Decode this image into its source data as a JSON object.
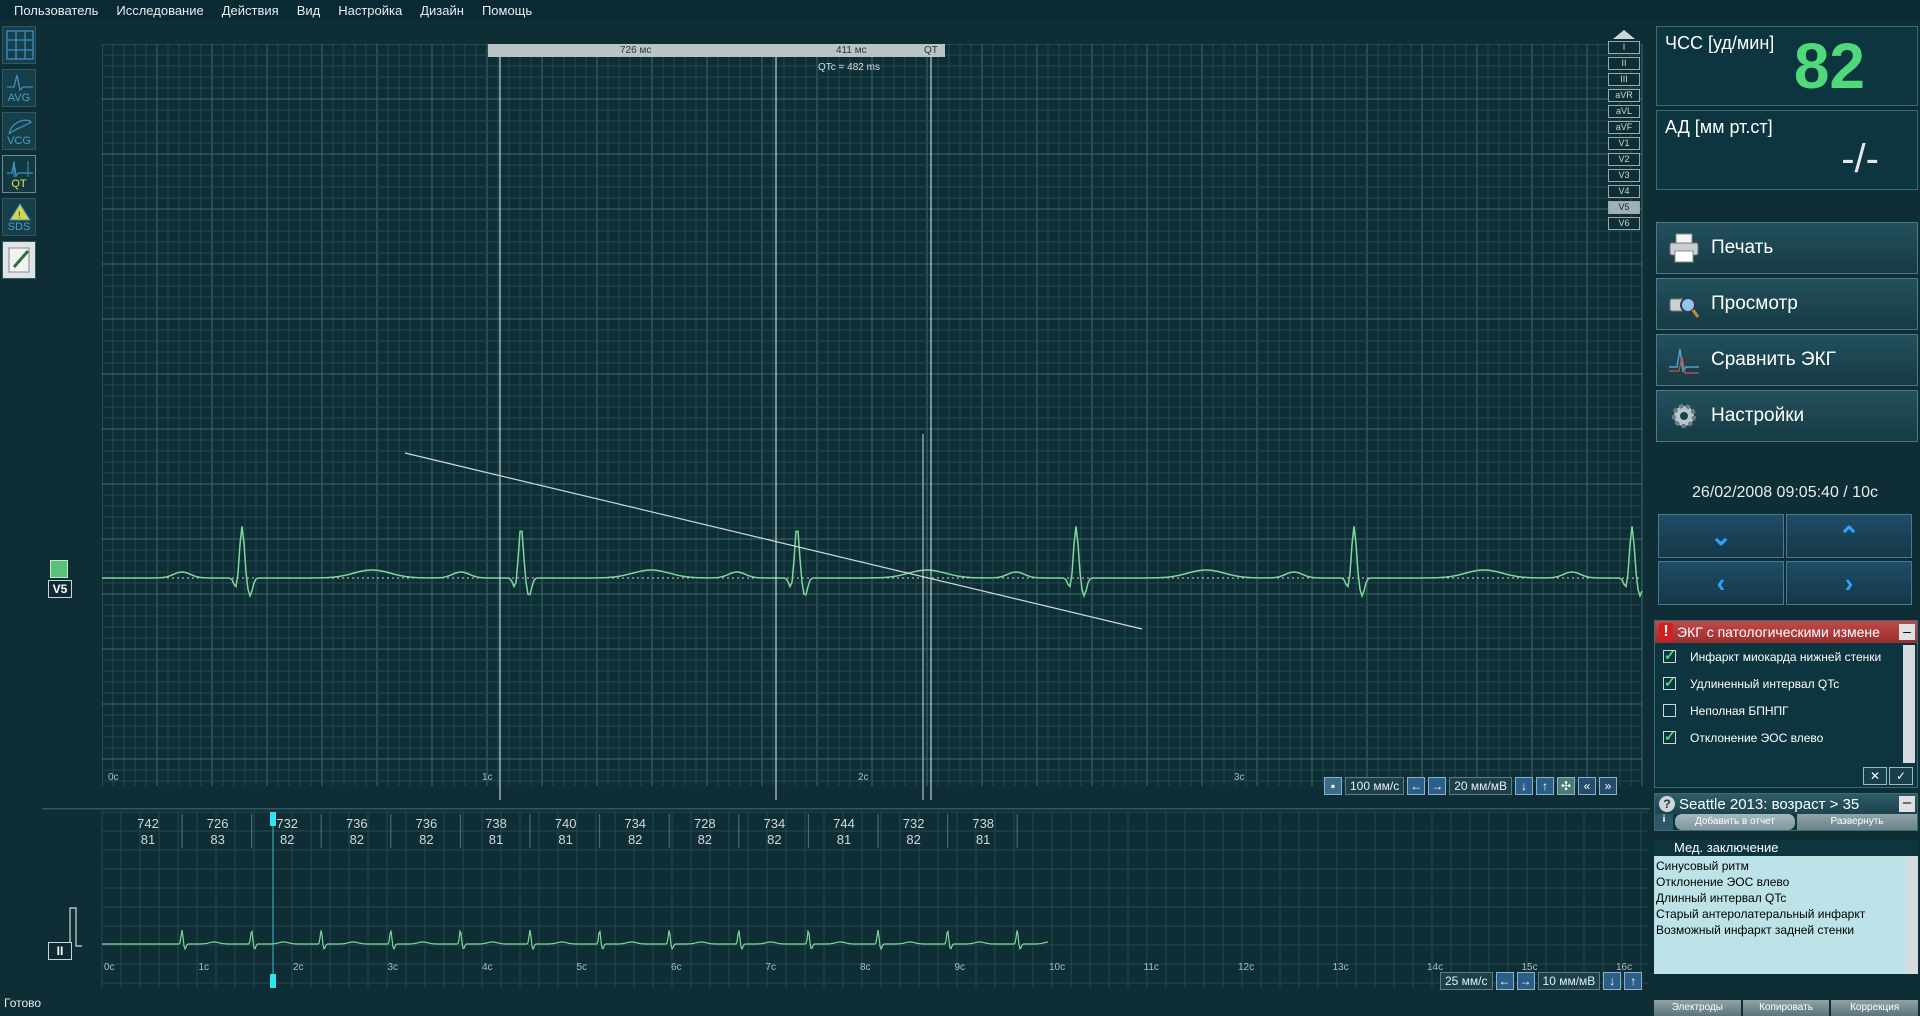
{
  "menu": [
    "Пользователь",
    "Исследование",
    "Действия",
    "Вид",
    "Настройка",
    "Дизайн",
    "Помощь"
  ],
  "tools": [
    {
      "name": "grid-view-tool",
      "label": ""
    },
    {
      "name": "avg-tool",
      "label": "AVG"
    },
    {
      "name": "vcg-tool",
      "label": "VCG"
    },
    {
      "name": "qt-tool",
      "label": "QT"
    },
    {
      "name": "sds-tool",
      "label": "SDS"
    },
    {
      "name": "edit-tool",
      "label": ""
    }
  ],
  "leads": [
    "I",
    "II",
    "III",
    "aVR",
    "aVL",
    "aVF",
    "V1",
    "V2",
    "V3",
    "V4",
    "V5",
    "V6"
  ],
  "selected_lead": "V5",
  "caliper": {
    "rr": "726 мс",
    "qt": "411 мс",
    "qt_label": "QT",
    "qtc": "QTc = 482 ms"
  },
  "main_time_labels": [
    "0c",
    "1c",
    "2c",
    "3c"
  ],
  "main_controls": {
    "speed": "100 мм/с",
    "gain": "20 мм/мВ"
  },
  "rhythm": {
    "lead": "II",
    "rr": [
      "742",
      "726",
      "732",
      "736",
      "736",
      "738",
      "740",
      "734",
      "728",
      "734",
      "744",
      "732",
      "738"
    ],
    "hr": [
      "81",
      "83",
      "82",
      "82",
      "82",
      "81",
      "81",
      "82",
      "82",
      "82",
      "81",
      "82",
      "81"
    ],
    "time_labels": [
      "0c",
      "1c",
      "2c",
      "3c",
      "4c",
      "5c",
      "6c",
      "7c",
      "8c",
      "9c",
      "10c",
      "11c",
      "12c",
      "13c",
      "14c",
      "15c",
      "16c"
    ],
    "speed": "25 мм/с",
    "gain": "10 мм/мВ"
  },
  "status": "Готово",
  "right": {
    "hr_label": "ЧСС [уд/мин]",
    "hr_value": "82",
    "bp_label": "АД [мм рт.ст]",
    "bp_value": "-/-",
    "buttons": [
      "Печать",
      "Просмотр",
      "Сравнить ЭКГ",
      "Настройки"
    ],
    "datetime": "26/02/2008 09:05:40 / 10c",
    "pathology_title": "ЭКГ с патологическими измене",
    "pathology_items": [
      {
        "label": "Инфаркт миокарда нижней стенки",
        "checked": true
      },
      {
        "label": "Удлиненный интервал QTc",
        "checked": true
      },
      {
        "label": "Неполная БПНПГ",
        "checked": false
      },
      {
        "label": "Отклонение ЭОС влево",
        "checked": true
      }
    ],
    "seattle_title": "Seattle 2013: возраст > 35",
    "seattle_add": "Добавить в отчет",
    "seattle_expand": "Развернуть",
    "med_title": "Мед. заключение",
    "med_lines": [
      "Синусовый ритм",
      "Отклонение ЭОС влево",
      "Длинный интервал QTc",
      "Старый антеролатеральный инфаркт",
      "Возможный инфаркт задней стенки"
    ],
    "med_buttons": [
      "Электроды",
      "Копировать",
      "Коррекция"
    ]
  },
  "colors": {
    "background": "#0f2d35",
    "ecg_trace": "#7fd89a",
    "hr_value": "#4fd97a",
    "nav_arrow": "#2ea3ff"
  }
}
